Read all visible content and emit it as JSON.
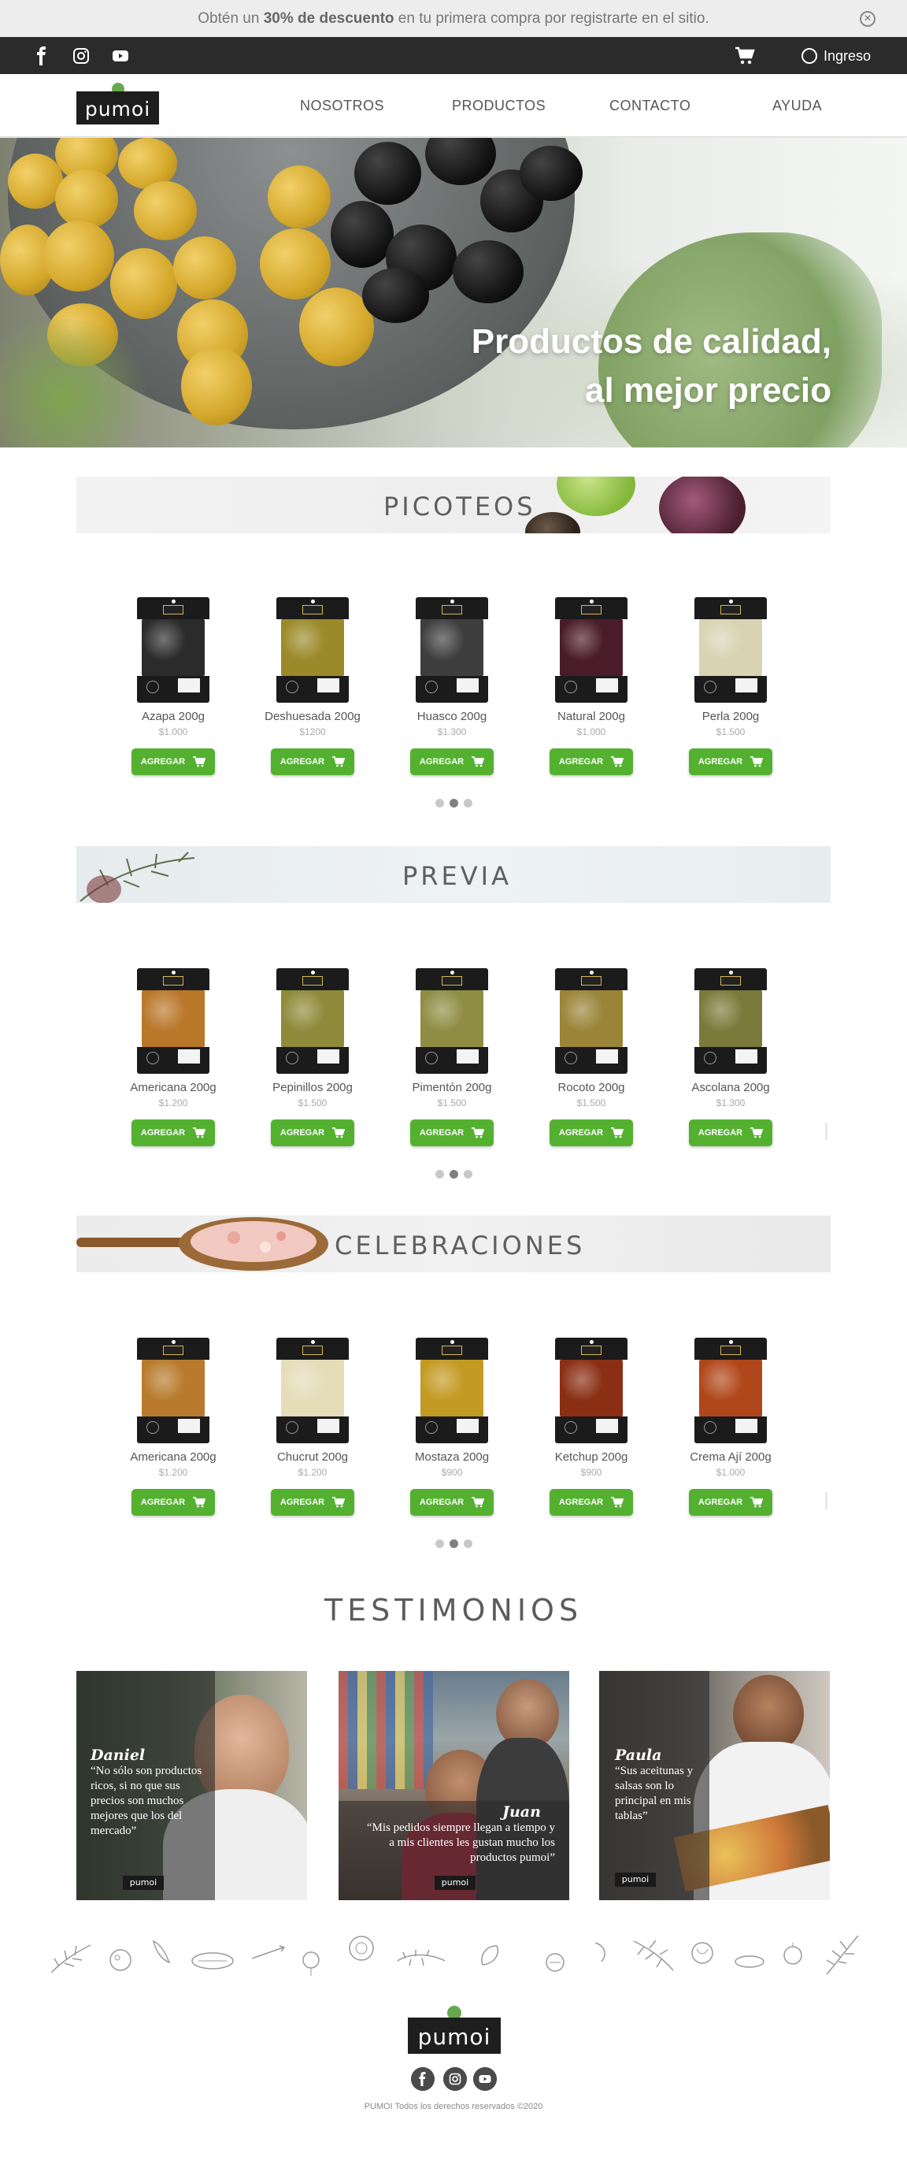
{
  "promo": {
    "text_before": "Obtén un ",
    "highlight": "30% de descuento",
    "text_after": " en tu primera compra por registrarte en el sitio.",
    "close_icon": "close-icon"
  },
  "top_bar": {
    "social_icons": [
      "facebook-icon",
      "instagram-icon",
      "youtube-icon"
    ],
    "cart_icon": "cart-icon",
    "login_label": "Ingreso"
  },
  "nav": {
    "logo_text": "pumoi",
    "links": [
      "NOSOTROS",
      "PRODUCTOS",
      "CONTACTO",
      "AYUDA"
    ]
  },
  "hero": {
    "line1": "Productos de calidad,",
    "line2": "al mejor precio"
  },
  "sections": [
    {
      "title": "PICOTEOS",
      "button_label": "AGREGAR",
      "products": [
        {
          "name": "Azapa 200g",
          "price": "$1.000",
          "color": "#2b2b2b"
        },
        {
          "name": "Deshuesada 200g",
          "price": "$1200",
          "color": "#9b8a2a"
        },
        {
          "name": "Huasco 200g",
          "price": "$1.300",
          "color": "#3e3e3e"
        },
        {
          "name": "Natural 200g",
          "price": "$1.000",
          "color": "#4a1c2a"
        },
        {
          "name": "Perla 200g",
          "price": "$1.500",
          "color": "#d9d3b4"
        }
      ]
    },
    {
      "title": "PREVIA",
      "button_label": "AGREGAR",
      "products": [
        {
          "name": "Americana 200g",
          "price": "$1.200",
          "color": "#b9772a"
        },
        {
          "name": "Pepinillos 200g",
          "price": "$1.500",
          "color": "#8e8a3a"
        },
        {
          "name": "Pimentón 200g",
          "price": "$1.500",
          "color": "#8f8d44"
        },
        {
          "name": "Rocoto 200g",
          "price": "$1.500",
          "color": "#9a8438"
        },
        {
          "name": "Ascolana 200g",
          "price": "$1.300",
          "color": "#7c7a3a"
        }
      ]
    },
    {
      "title": "CELEBRACIONES",
      "button_label": "AGREGAR",
      "products": [
        {
          "name": "Americana 200g",
          "price": "$1.200",
          "color": "#b87a2c"
        },
        {
          "name": "Chucrut 200g",
          "price": "$1.200",
          "color": "#e5dcb8"
        },
        {
          "name": "Mostaza 200g",
          "price": "$900",
          "color": "#c39a22"
        },
        {
          "name": "Ketchup 200g",
          "price": "$900",
          "color": "#8a2e14"
        },
        {
          "name": "Crema Ají 200g",
          "price": "$1.000",
          "color": "#b0471a"
        }
      ]
    }
  ],
  "testimonials": {
    "title": "TESTIMONIOS",
    "items": [
      {
        "name": "Daniel",
        "quote": "“No sólo son productos ricos, si no que sus precios son muchos mejores que los del mercado”"
      },
      {
        "name": "Juan",
        "quote": "“Mis pedidos siempre llegan a tiempo y a mis clientes les gustan mucho los productos pumoi”"
      },
      {
        "name": "Paula",
        "quote": "“Sus aceitunas y salsas son lo principal en mis tablas”"
      }
    ],
    "card_logo": "pumoi"
  },
  "footer": {
    "logo_text": "pumoi",
    "social_icons": [
      "facebook-icon",
      "instagram-icon",
      "youtube-icon"
    ],
    "copyright": "PUMOI Todos los derechos reservados ©2020"
  },
  "colors": {
    "accent_green": "#54b130",
    "dark_bar": "#2b2b2b"
  }
}
